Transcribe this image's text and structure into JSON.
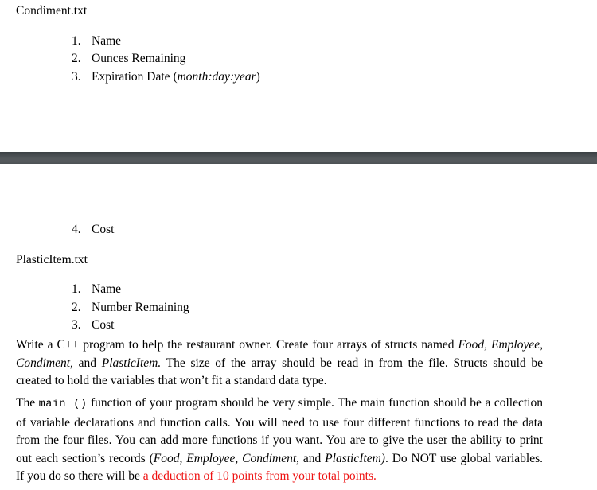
{
  "document": {
    "sections": [
      {
        "heading": "Condiment.txt",
        "items": [
          {
            "num": "1.",
            "text": "Name"
          },
          {
            "num": "2.",
            "text": "Ounces Remaining"
          },
          {
            "num": "3.",
            "text": "Expiration Date (",
            "italic": "month:day:year",
            "after": ")"
          }
        ]
      },
      {
        "continued_item": {
          "num": "4.",
          "text": "Cost"
        },
        "heading": "PlasticItem.txt",
        "items": [
          {
            "num": "1.",
            "text": "Name"
          },
          {
            "num": "2.",
            "text": "Number Remaining"
          },
          {
            "num": "3.",
            "text": "Cost"
          }
        ]
      }
    ],
    "paragraphs": {
      "p1": {
        "s1": "Write a C++ program to help the restaurant owner. Create four arrays of structs named ",
        "i1": "Food, Employee, Condiment,",
        "s2": " and ",
        "i2": "PlasticItem.",
        "s3": " The size of the array should be read in from the file. Structs should be created to hold the variables that won’t fit a standard data type."
      },
      "p2": {
        "s1": "The ",
        "code": "main ()",
        "s2": " function of your program should be very simple. The main function should be a collection of variable declarations and function calls. You will need to use four different functions to read the data from the four files. You can add more functions if you want.  You are to give the user the ability to print out each section’s records (",
        "i1": "Food, Employee, Condiment,",
        "s3": " and ",
        "i2": "PlasticItem)",
        "s4": ". Do NOT use global variables. If you do so there will be ",
        "red": "a deduction of 10 points from your total points."
      }
    },
    "colors": {
      "page_break_bar": "#4b5053",
      "warning_red": "#ee1111",
      "text": "#000000",
      "background": "#ffffff"
    }
  }
}
